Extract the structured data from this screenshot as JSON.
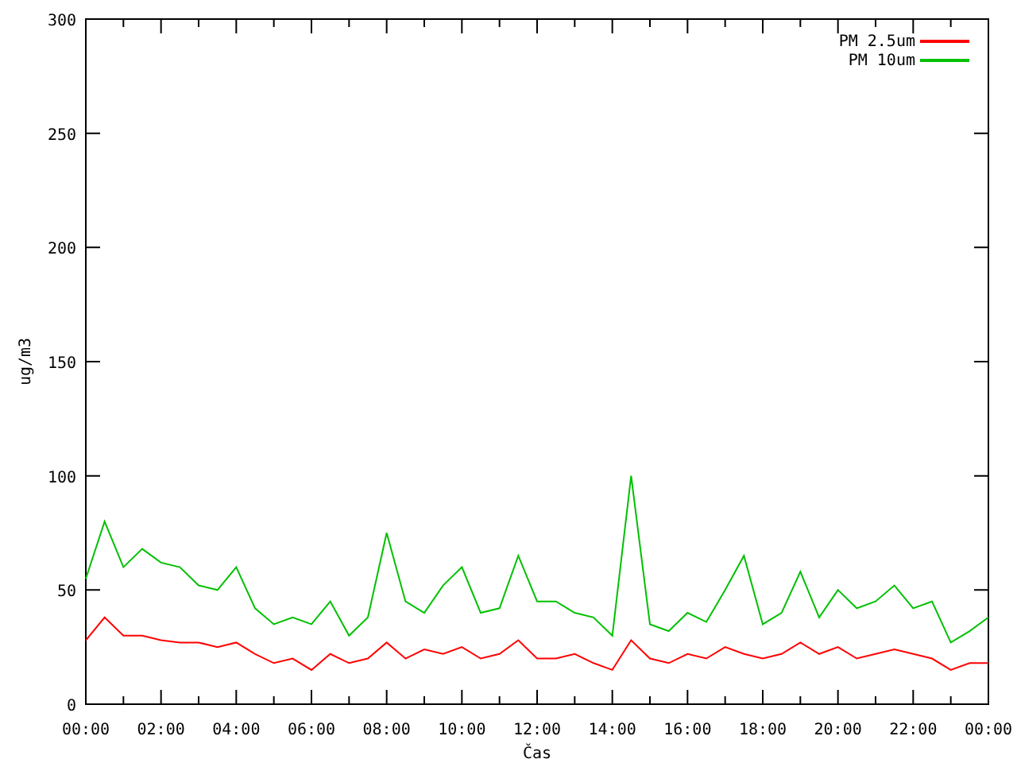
{
  "chart": {
    "chart_data": {
      "type": "line",
      "xlabel": "Čas",
      "ylabel": "ug/m3",
      "xlim": [
        0,
        24
      ],
      "ylim": [
        0,
        300
      ],
      "xticks": [
        {
          "value": 0,
          "label": "00:00"
        },
        {
          "value": 2,
          "label": "02:00"
        },
        {
          "value": 4,
          "label": "04:00"
        },
        {
          "value": 6,
          "label": "06:00"
        },
        {
          "value": 8,
          "label": "08:00"
        },
        {
          "value": 10,
          "label": "10:00"
        },
        {
          "value": 12,
          "label": "12:00"
        },
        {
          "value": 14,
          "label": "14:00"
        },
        {
          "value": 16,
          "label": "16:00"
        },
        {
          "value": 18,
          "label": "18:00"
        },
        {
          "value": 20,
          "label": "20:00"
        },
        {
          "value": 22,
          "label": "22:00"
        },
        {
          "value": 24,
          "label": "00:00"
        }
      ],
      "yticks": [
        0,
        50,
        100,
        150,
        200,
        250,
        300
      ],
      "legend": "top-right",
      "x": [
        0,
        0.5,
        1,
        1.5,
        2,
        2.5,
        3,
        3.5,
        4,
        4.5,
        5,
        5.5,
        6,
        6.5,
        7,
        7.5,
        8,
        8.5,
        9,
        9.5,
        10,
        10.5,
        11,
        11.5,
        12,
        12.5,
        13,
        13.5,
        14,
        14.5,
        15,
        15.5,
        16,
        16.5,
        17,
        17.5,
        18,
        18.5,
        19,
        19.5,
        20,
        20.5,
        21,
        21.5,
        22,
        22.5,
        23,
        23.5,
        24
      ],
      "series": [
        {
          "name": "PM 2.5um",
          "color": "#ff0000",
          "values": [
            28,
            38,
            30,
            30,
            28,
            27,
            27,
            25,
            27,
            22,
            18,
            20,
            15,
            22,
            18,
            20,
            27,
            20,
            24,
            22,
            25,
            20,
            22,
            28,
            20,
            20,
            22,
            18,
            15,
            28,
            20,
            18,
            22,
            20,
            25,
            22,
            20,
            22,
            27,
            22,
            25,
            20,
            22,
            24,
            22,
            20,
            15,
            18,
            18
          ]
        },
        {
          "name": "PM 10um",
          "color": "#00c000",
          "values": [
            55,
            80,
            60,
            68,
            62,
            60,
            52,
            50,
            60,
            42,
            35,
            38,
            35,
            45,
            30,
            38,
            75,
            45,
            40,
            52,
            60,
            40,
            42,
            65,
            45,
            45,
            40,
            38,
            30,
            100,
            35,
            32,
            40,
            36,
            50,
            65,
            35,
            40,
            58,
            38,
            50,
            42,
            45,
            52,
            42,
            45,
            27,
            32,
            38
          ]
        }
      ]
    }
  }
}
